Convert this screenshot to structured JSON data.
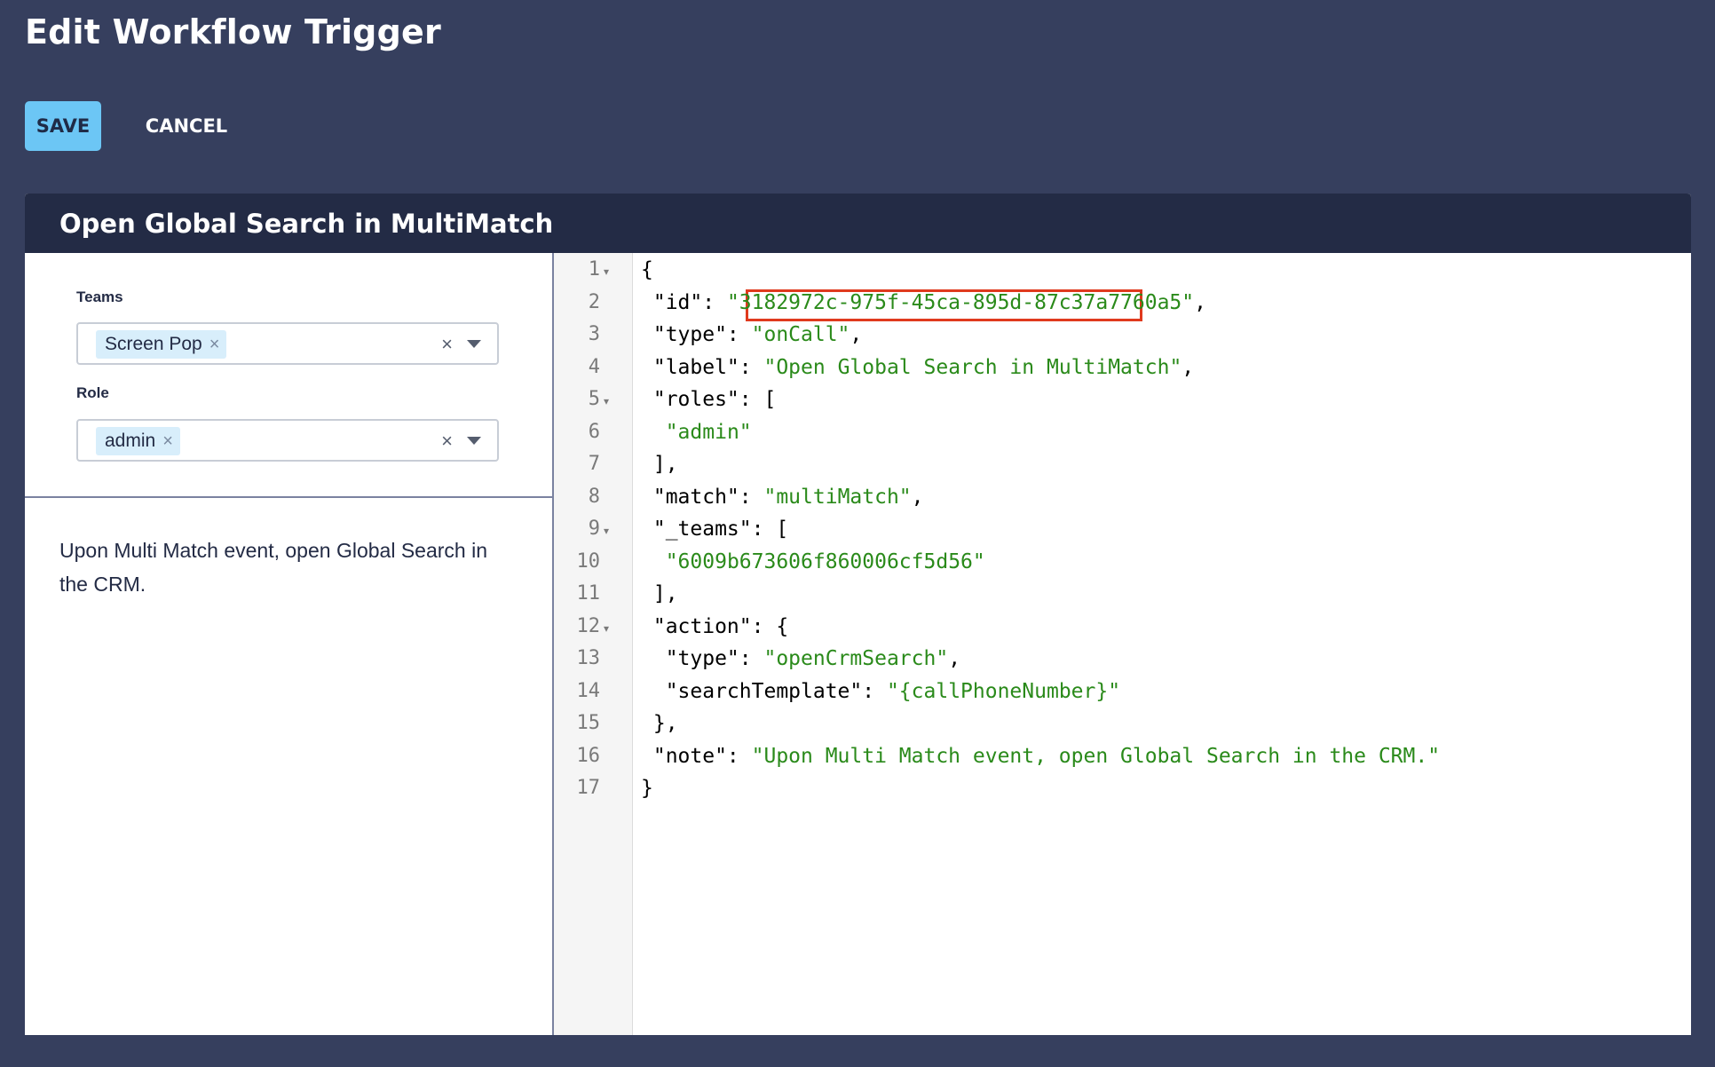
{
  "page": {
    "title": "Edit Workflow Trigger"
  },
  "toolbar": {
    "save_label": "SAVE",
    "cancel_label": "CANCEL"
  },
  "card": {
    "title": "Open Global Search in MultiMatch"
  },
  "form": {
    "teams": {
      "label": "Teams",
      "chip": "Screen Pop",
      "chip_remove": "×",
      "clear": "×"
    },
    "role": {
      "label": "Role",
      "chip": "admin",
      "chip_remove": "×",
      "clear": "×"
    }
  },
  "note": "Upon Multi Match event, open Global Search in the CRM.",
  "editor": {
    "line_numbers": [
      "1",
      "2",
      "3",
      "4",
      "5",
      "6",
      "7",
      "8",
      "9",
      "10",
      "11",
      "12",
      "13",
      "14",
      "15",
      "16",
      "17"
    ],
    "lines": [
      [
        {
          "t": "{"
        }
      ],
      [
        {
          "t": " \"id\": "
        },
        {
          "t": "\"3182972c-975f-45ca-895d-87c37a7760a5\"",
          "s": 1
        },
        {
          "t": ","
        }
      ],
      [
        {
          "t": " \"type\": "
        },
        {
          "t": "\"onCall\"",
          "s": 1
        },
        {
          "t": ","
        }
      ],
      [
        {
          "t": " \"label\": "
        },
        {
          "t": "\"Open Global Search in MultiMatch\"",
          "s": 1
        },
        {
          "t": ","
        }
      ],
      [
        {
          "t": " \"roles\": ["
        }
      ],
      [
        {
          "t": "  "
        },
        {
          "t": "\"admin\"",
          "s": 1
        }
      ],
      [
        {
          "t": " ],"
        }
      ],
      [
        {
          "t": " \"match\": "
        },
        {
          "t": "\"multiMatch\"",
          "s": 1
        },
        {
          "t": ","
        }
      ],
      [
        {
          "t": " \"_teams\": ["
        }
      ],
      [
        {
          "t": "  "
        },
        {
          "t": "\"6009b673606f860006cf5d56\"",
          "s": 1
        }
      ],
      [
        {
          "t": " ],"
        }
      ],
      [
        {
          "t": " \"action\": {"
        }
      ],
      [
        {
          "t": "  \"type\": "
        },
        {
          "t": "\"openCrmSearch\"",
          "s": 1
        },
        {
          "t": ","
        }
      ],
      [
        {
          "t": "  \"searchTemplate\": "
        },
        {
          "t": "\"{callPhoneNumber}\"",
          "s": 1
        }
      ],
      [
        {
          "t": " },"
        }
      ],
      [
        {
          "t": " \"note\": "
        },
        {
          "t": "\"Upon Multi Match event, open Global Search in the CRM.\"",
          "s": 1
        }
      ],
      [
        {
          "t": "}"
        }
      ]
    ],
    "fold_lines": [
      1,
      5,
      9,
      12
    ],
    "highlighted_value": "\"3182972c-975f-45ca-895d-87c37a7760a5\""
  },
  "colors": {
    "background": "#363f5e",
    "header": "#232b45",
    "save_button": "#6cc6f5",
    "string": "#2a8a1a",
    "highlight_box": "#e03a1e"
  }
}
